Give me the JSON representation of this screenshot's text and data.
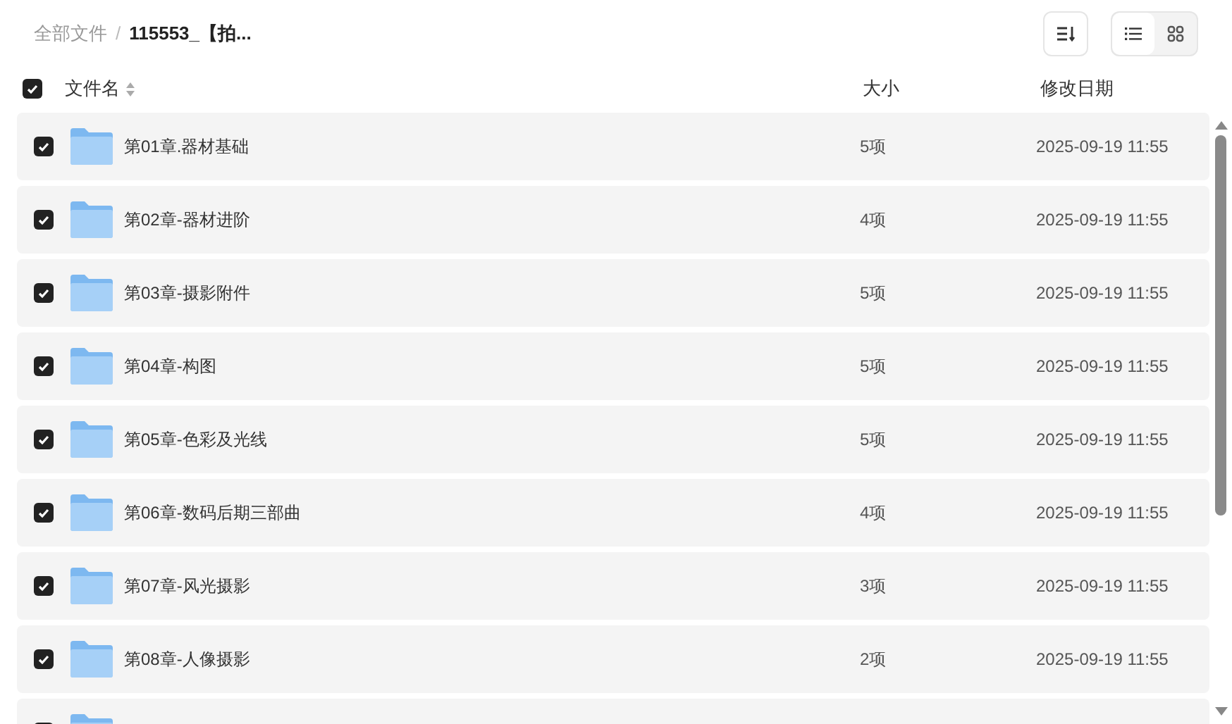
{
  "breadcrumb_separator": "/",
  "breadcrumb": [
    {
      "label": "全部文件",
      "current": false
    },
    {
      "label": "115553_【拍...",
      "current": true
    }
  ],
  "view_modes": [
    {
      "kind": "list",
      "selected": true
    },
    {
      "kind": "grid",
      "selected": false
    }
  ],
  "header": {
    "checked": true,
    "columns": [
      "文件名",
      "大小",
      "修改日期"
    ]
  },
  "rows": [
    {
      "checked": true,
      "name": "第01章.器材基础",
      "size": "5项",
      "date": "2025-09-19 11:55"
    },
    {
      "checked": true,
      "name": "第02章-器材进阶",
      "size": "4项",
      "date": "2025-09-19 11:55"
    },
    {
      "checked": true,
      "name": "第03章-摄影附件",
      "size": "5项",
      "date": "2025-09-19 11:55"
    },
    {
      "checked": true,
      "name": "第04章-构图",
      "size": "5项",
      "date": "2025-09-19 11:55"
    },
    {
      "checked": true,
      "name": "第05章-色彩及光线",
      "size": "5项",
      "date": "2025-09-19 11:55"
    },
    {
      "checked": true,
      "name": "第06章-数码后期三部曲",
      "size": "4项",
      "date": "2025-09-19 11:55"
    },
    {
      "checked": true,
      "name": "第07章-风光摄影",
      "size": "3项",
      "date": "2025-09-19 11:55"
    },
    {
      "checked": true,
      "name": "第08章-人像摄影",
      "size": "2项",
      "date": "2025-09-19 11:55"
    },
    {
      "checked": true
    }
  ]
}
